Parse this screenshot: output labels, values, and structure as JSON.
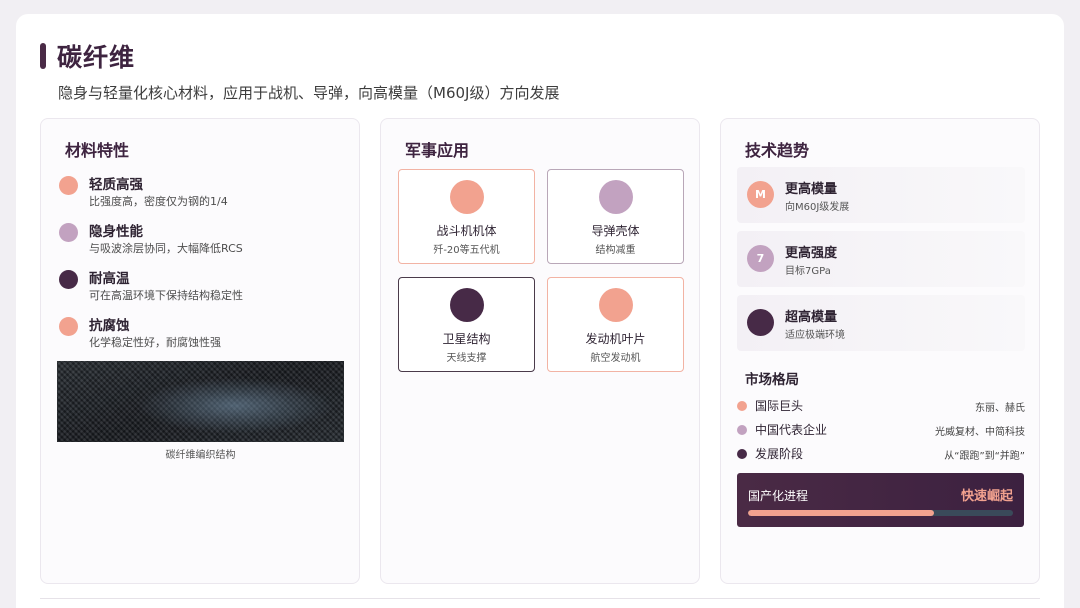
{
  "title": "碳纤维",
  "subtitle": "隐身与轻量化核心材料，应用于战机、导弹，向高模量（M60J级）方向发展",
  "colors": {
    "salmon": "#f2a28f",
    "lavender": "#c2a2c0",
    "plum": "#472a47"
  },
  "properties": {
    "title": "材料特性",
    "items": [
      {
        "name": "轻质高强",
        "desc": "比强度高，密度仅为钢的1/4",
        "color": "#f2a28f"
      },
      {
        "name": "隐身性能",
        "desc": "与吸波涂层协同，大幅降低RCS",
        "color": "#c2a2c0"
      },
      {
        "name": "耐高温",
        "desc": "可在高温环境下保持结构稳定性",
        "color": "#472a47"
      },
      {
        "name": "抗腐蚀",
        "desc": "化学稳定性好，耐腐蚀性强",
        "color": "#f2a28f"
      }
    ],
    "image_caption": "碳纤维编织结构"
  },
  "applications": {
    "title": "军事应用",
    "items": [
      {
        "name": "战斗机机体",
        "desc": "歼-20等五代机",
        "color": "#f2a28f",
        "border": "#f2b3a4"
      },
      {
        "name": "导弹壳体",
        "desc": "结构减重",
        "color": "#c2a2c0",
        "border": "#b9a7b8"
      },
      {
        "name": "卫星结构",
        "desc": "天线支撑",
        "color": "#472a47",
        "border": "#4a3a4a"
      },
      {
        "name": "发动机叶片",
        "desc": "航空发动机",
        "color": "#f2a28f",
        "border": "#f2b3a4"
      }
    ]
  },
  "trends": {
    "title": "技术趋势",
    "items": [
      {
        "badge": "M",
        "name": "更高模量",
        "desc": "向M60J级发展",
        "color": "#f2a28f"
      },
      {
        "badge": "7",
        "name": "更高强度",
        "desc": "目标7GPa",
        "color": "#c2a2c0"
      },
      {
        "badge": "",
        "name": "超高模量",
        "desc": "适应极端环境",
        "color": "#472a47"
      }
    ],
    "market": {
      "title": "市场格局",
      "rows": [
        {
          "label": "国际巨头",
          "value": "东丽、赫氏",
          "color": "#f2a28f"
        },
        {
          "label": "中国代表企业",
          "value": "光威复材、中简科技",
          "color": "#c2a2c0"
        },
        {
          "label": "发展阶段",
          "value": "从“跟跑”到“并跑”",
          "color": "#472a47"
        }
      ]
    },
    "progress": {
      "label": "国产化进程",
      "status": "快速崛起",
      "fraction": 0.7
    }
  }
}
